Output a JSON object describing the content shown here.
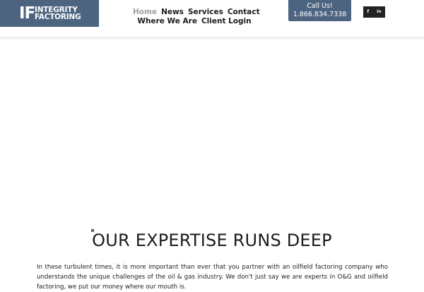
{
  "logo": {
    "mark": "IF",
    "line1": "INTEGRITY",
    "line2": "FACTORING"
  },
  "nav": {
    "items": [
      {
        "label": "Home",
        "active": true
      },
      {
        "label": "News",
        "active": false
      },
      {
        "label": "Services",
        "active": false
      },
      {
        "label": "Contact",
        "active": false
      },
      {
        "label": "Where We Are",
        "active": false
      },
      {
        "label": "Client Login",
        "active": false
      }
    ]
  },
  "call": {
    "label": "Call Us!",
    "phone": "1.866.834.7338"
  },
  "social": {
    "facebook": "f",
    "linkedin": "in"
  },
  "expertise": {
    "heading": "OUR EXPERTISE RUNS DEEP",
    "body": "In these turbulent times, it is more important than ever that you partner with an oilfield factoring company who understands the unique challenges of the oil & gas industry. We don't just say we are experts in O&G and oilfield factoring, we put our money where our mouth is."
  },
  "colors": {
    "brand": "#4d6480",
    "nav_active": "#9ea1a5",
    "text": "#1c1c1c",
    "social_bg": "#222222"
  }
}
